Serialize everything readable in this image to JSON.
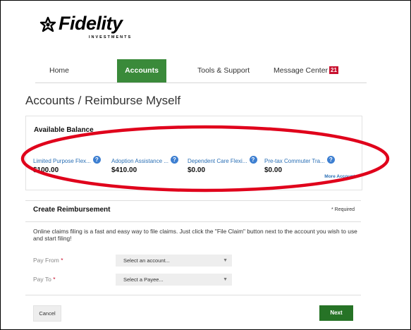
{
  "brand": {
    "name": "Fidelity",
    "tagline": "INVESTMENTS",
    "icon": "fidelity-pyramid-icon"
  },
  "nav": {
    "items": [
      {
        "label": "Home",
        "active": false
      },
      {
        "label": "Accounts",
        "active": true
      },
      {
        "label": "Tools & Support",
        "active": false
      },
      {
        "label": "Message Center",
        "active": false,
        "badge": "21"
      }
    ]
  },
  "page": {
    "title": "Accounts / Reimburse Myself"
  },
  "balance": {
    "heading": "Available Balance",
    "accounts": [
      {
        "name": "Limited Purpose Flex...",
        "amount": "$100.00"
      },
      {
        "name": "Adoption Assistance ...",
        "amount": "$410.00"
      },
      {
        "name": "Dependent Care Flexi...",
        "amount": "$0.00"
      },
      {
        "name": "Pre-tax Commuter Tra...",
        "amount": "$0.00"
      }
    ],
    "more_link": "More Accounts",
    "help_icon_glyph": "?"
  },
  "reimbursement": {
    "heading": "Create Reimbursement",
    "required_note": "* Required",
    "info": "Online claims filing is a fast and easy way to file claims. Just click the \"File Claim\" button next to the account you wish to use and start filing!",
    "pay_from": {
      "label": "Pay From",
      "required_mark": "*",
      "placeholder": "Select an account..."
    },
    "pay_to": {
      "label": "Pay To",
      "required_mark": "*",
      "placeholder": "Select a Payee..."
    },
    "cancel_label": "Cancel",
    "next_label": "Next"
  },
  "colors": {
    "brand_green": "#3a8a3a",
    "next_green": "#267326",
    "link_blue": "#2a6fb5",
    "badge_red": "#c8102e",
    "annotation_red": "#e0001b"
  }
}
